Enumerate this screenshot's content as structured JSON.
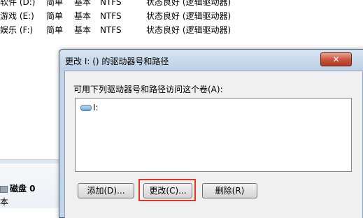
{
  "volumes": [
    {
      "name": "软件 (D:)",
      "layout": "简单",
      "type": "基本",
      "fs": "NTFS",
      "status": "状态良好 (逻辑驱动器)"
    },
    {
      "name": "游戏 (E:)",
      "layout": "简单",
      "type": "基本",
      "fs": "NTFS",
      "status": "状态良好 (逻辑驱动器)"
    },
    {
      "name": "娱乐 (F:)",
      "layout": "简单",
      "type": "基本",
      "fs": "NTFS",
      "status": "状态良好 (逻辑驱动器)"
    }
  ],
  "disk": {
    "label": "磁盘 0",
    "sub": "本"
  },
  "dialog": {
    "title": "更改 I: () 的驱动器号和路径",
    "close": "✕",
    "prompt": "可用下列驱动器号和路径访问这个卷(A):",
    "list_items": [
      "I:"
    ],
    "add_label": "添加(D)...",
    "change_label": "更改(C)...",
    "delete_label": "删除(R)"
  },
  "colors": {
    "highlight": "#e5342a",
    "close_button": "#c8523a",
    "title_bar": "#c3d5e8"
  }
}
